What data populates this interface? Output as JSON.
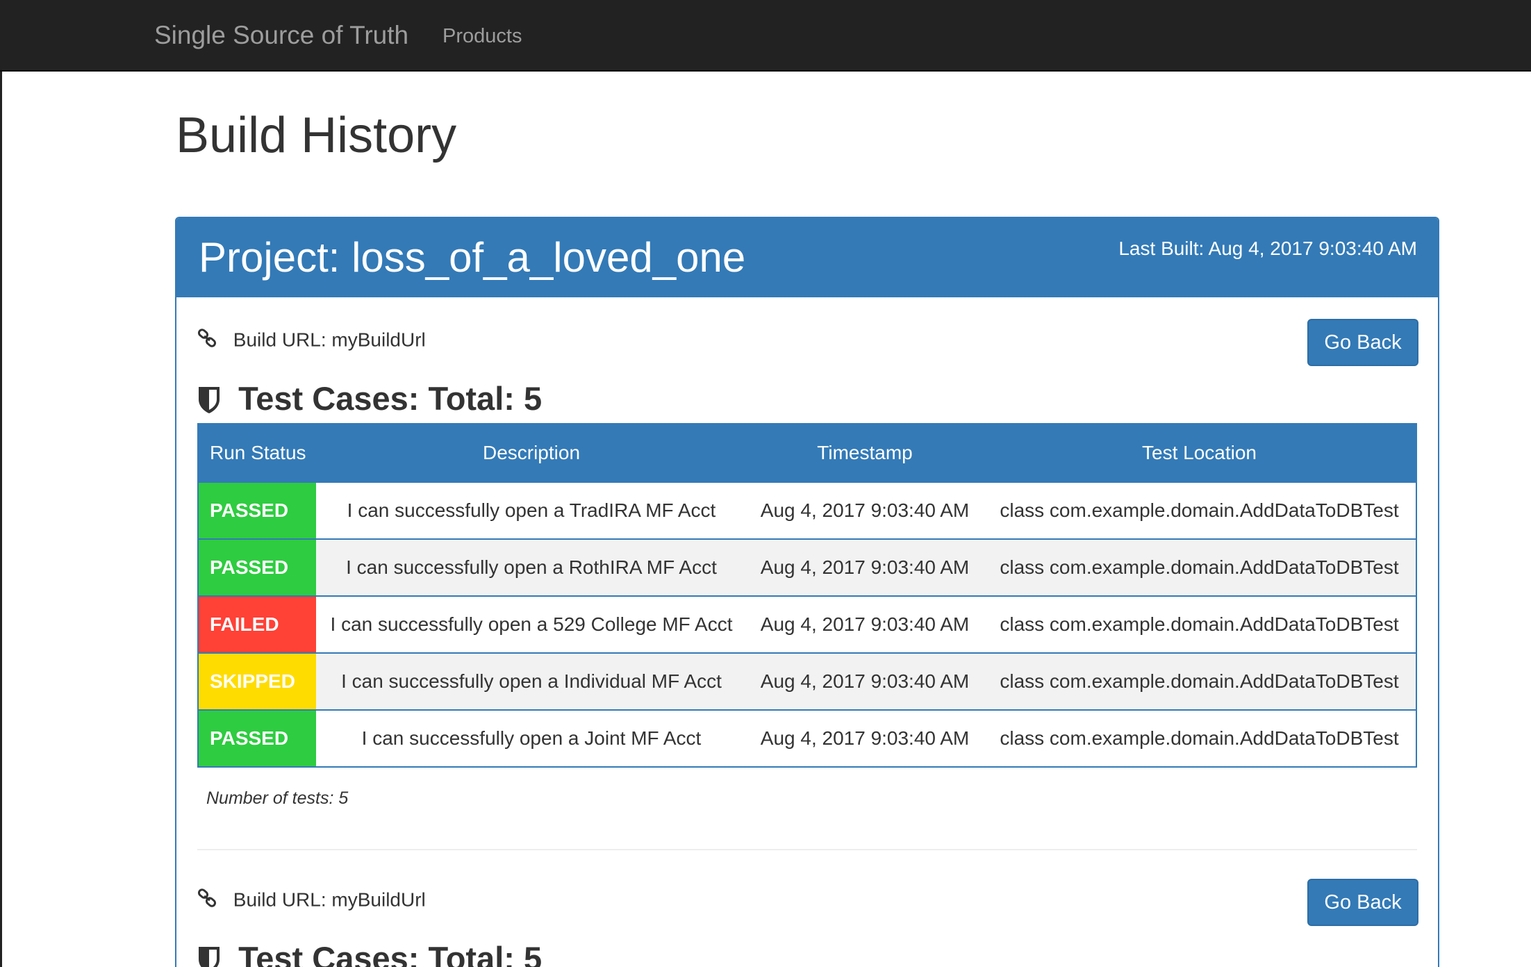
{
  "navbar": {
    "brand": "Single Source of Truth",
    "links": [
      "Products"
    ]
  },
  "page": {
    "title": "Build History"
  },
  "panel": {
    "project_title": "Project: loss_of_a_loved_one",
    "last_built": "Last Built: Aug 4, 2017 9:03:40 AM",
    "builds": [
      {
        "build_url": "Build URL: myBuildUrl",
        "go_back_label": "Go Back",
        "test_cases_title": "Test Cases: Total: 5",
        "columns": [
          "Run Status",
          "Description",
          "Timestamp",
          "Test Location"
        ],
        "rows": [
          {
            "status": "PASSED",
            "description": "I can successfully open a TradIRA MF Acct",
            "timestamp": "Aug 4, 2017 9:03:40 AM",
            "location": "class com.example.domain.AddDataToDBTest"
          },
          {
            "status": "PASSED",
            "description": "I can successfully open a RothIRA MF Acct",
            "timestamp": "Aug 4, 2017 9:03:40 AM",
            "location": "class com.example.domain.AddDataToDBTest"
          },
          {
            "status": "FAILED",
            "description": "I can successfully open a 529 College MF Acct",
            "timestamp": "Aug 4, 2017 9:03:40 AM",
            "location": "class com.example.domain.AddDataToDBTest"
          },
          {
            "status": "SKIPPED",
            "description": "I can successfully open a Individual MF Acct",
            "timestamp": "Aug 4, 2017 9:03:40 AM",
            "location": "class com.example.domain.AddDataToDBTest"
          },
          {
            "status": "PASSED",
            "description": "I can successfully open a Joint MF Acct",
            "timestamp": "Aug 4, 2017 9:03:40 AM",
            "location": "class com.example.domain.AddDataToDBTest"
          }
        ],
        "number_of_tests": "Number of tests: 5"
      },
      {
        "build_url": "Build URL: myBuildUrl",
        "go_back_label": "Go Back",
        "test_cases_title": "Test Cases: Total: 5"
      }
    ]
  },
  "status_colors": {
    "PASSED": "#2ecc40",
    "FAILED": "#ff4136",
    "SKIPPED": "#ffdc00"
  },
  "icons": {
    "build_url": "link-icon",
    "test_cases": "shield-icon"
  },
  "colors": {
    "navbar": "#222222",
    "primary": "#337ab7"
  }
}
